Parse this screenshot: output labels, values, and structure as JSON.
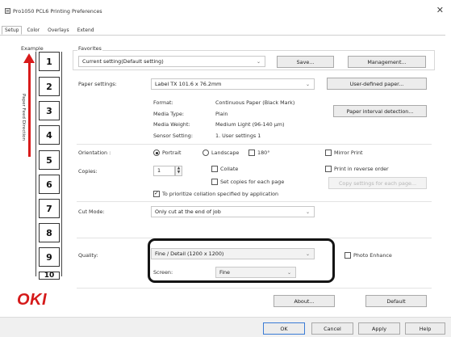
{
  "window": {
    "title": "Pro1050 PCL6 Printing Preferences",
    "close_glyph": "✕"
  },
  "tabs": [
    {
      "label": "Setup",
      "active": true
    },
    {
      "label": "Color",
      "active": false
    },
    {
      "label": "Overlays",
      "active": false
    },
    {
      "label": "Extend",
      "active": false
    }
  ],
  "preview": {
    "example_label": "Example",
    "feed_direction_label": "Paper Feed Direction",
    "labels": [
      "1",
      "2",
      "3",
      "4",
      "5",
      "6",
      "7",
      "8",
      "9",
      "10"
    ],
    "logo_text": "OKI",
    "arrow_color": "#d81b1b",
    "logo_color": "#d51a1a"
  },
  "favorites": {
    "label": "Favorites",
    "value": "Current setting(Default setting)",
    "save_label": "Save...",
    "management_label": "Management..."
  },
  "paper_settings": {
    "label": "Paper settings:",
    "value": "Label TX 101.6 x 76.2mm",
    "user_defined_label": "User-defined paper...",
    "interval_detection_label": "Paper interval detection...",
    "details": [
      {
        "key": "Format:",
        "value": "Continuous Paper (Black Mark)"
      },
      {
        "key": "Media Type:",
        "value": "Plain"
      },
      {
        "key": "Media Weight:",
        "value": "Medium Light (96-140 µm)"
      },
      {
        "key": "Sensor Setting:",
        "value": "1. User settings 1"
      }
    ]
  },
  "orientation": {
    "label": "Orientation :",
    "portrait": "Portrait",
    "landscape": "Landscape",
    "rotate180": "180°",
    "mirror_print": "Mirror Print",
    "selected": "portrait"
  },
  "copies": {
    "label": "Copies:",
    "value": "1",
    "collate": "Collate",
    "print_reverse": "Print in reverse order",
    "set_copies_each_page": "Set copies for each page",
    "prioritize_collation": "To prioritize collation specified by application",
    "copy_settings_label": "Copy settings for each page..."
  },
  "cut_mode": {
    "label": "Cut Mode:",
    "value": "Only cut at the end of job"
  },
  "quality": {
    "label": "Quality:",
    "value": "Fine / Detail (1200 x 1200)",
    "screen_label": "Screen:",
    "screen_value": "Fine",
    "photo_enhance": "Photo Enhance"
  },
  "footer": {
    "about_label": "About...",
    "default_label": "Default",
    "ok_label": "OK",
    "cancel_label": "Cancel",
    "apply_label": "Apply",
    "help_label": "Help"
  },
  "icons": {
    "dropdown": "chevron-down-icon",
    "spin": "spin-arrows-icon"
  }
}
